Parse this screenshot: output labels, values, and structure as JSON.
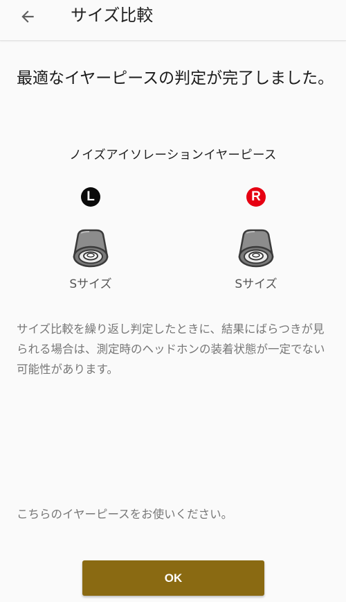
{
  "appbar": {
    "title": "サイズ比較",
    "back_icon": "arrow-back-icon"
  },
  "heading": "最適なイヤーピースの判定が完了しました。",
  "subtitle": "ノイズアイソレーションイヤーピース",
  "left": {
    "badge": "L",
    "badge_color": "#0a0a0a",
    "size": "Sサイズ",
    "icon": "earpiece-icon"
  },
  "right": {
    "badge": "R",
    "badge_color": "#e60012",
    "size": "Sサイズ",
    "icon": "earpiece-icon"
  },
  "note": "サイズ比較を繰り返し判定したときに、結果にばらつきが見られる場合は、測定時のヘッドホンの装着状態が一定でない可能性があります。",
  "bottom_note": "こちらのイヤーピースをお使いください。",
  "ok_button": {
    "label": "OK",
    "color": "#8a6a12"
  }
}
